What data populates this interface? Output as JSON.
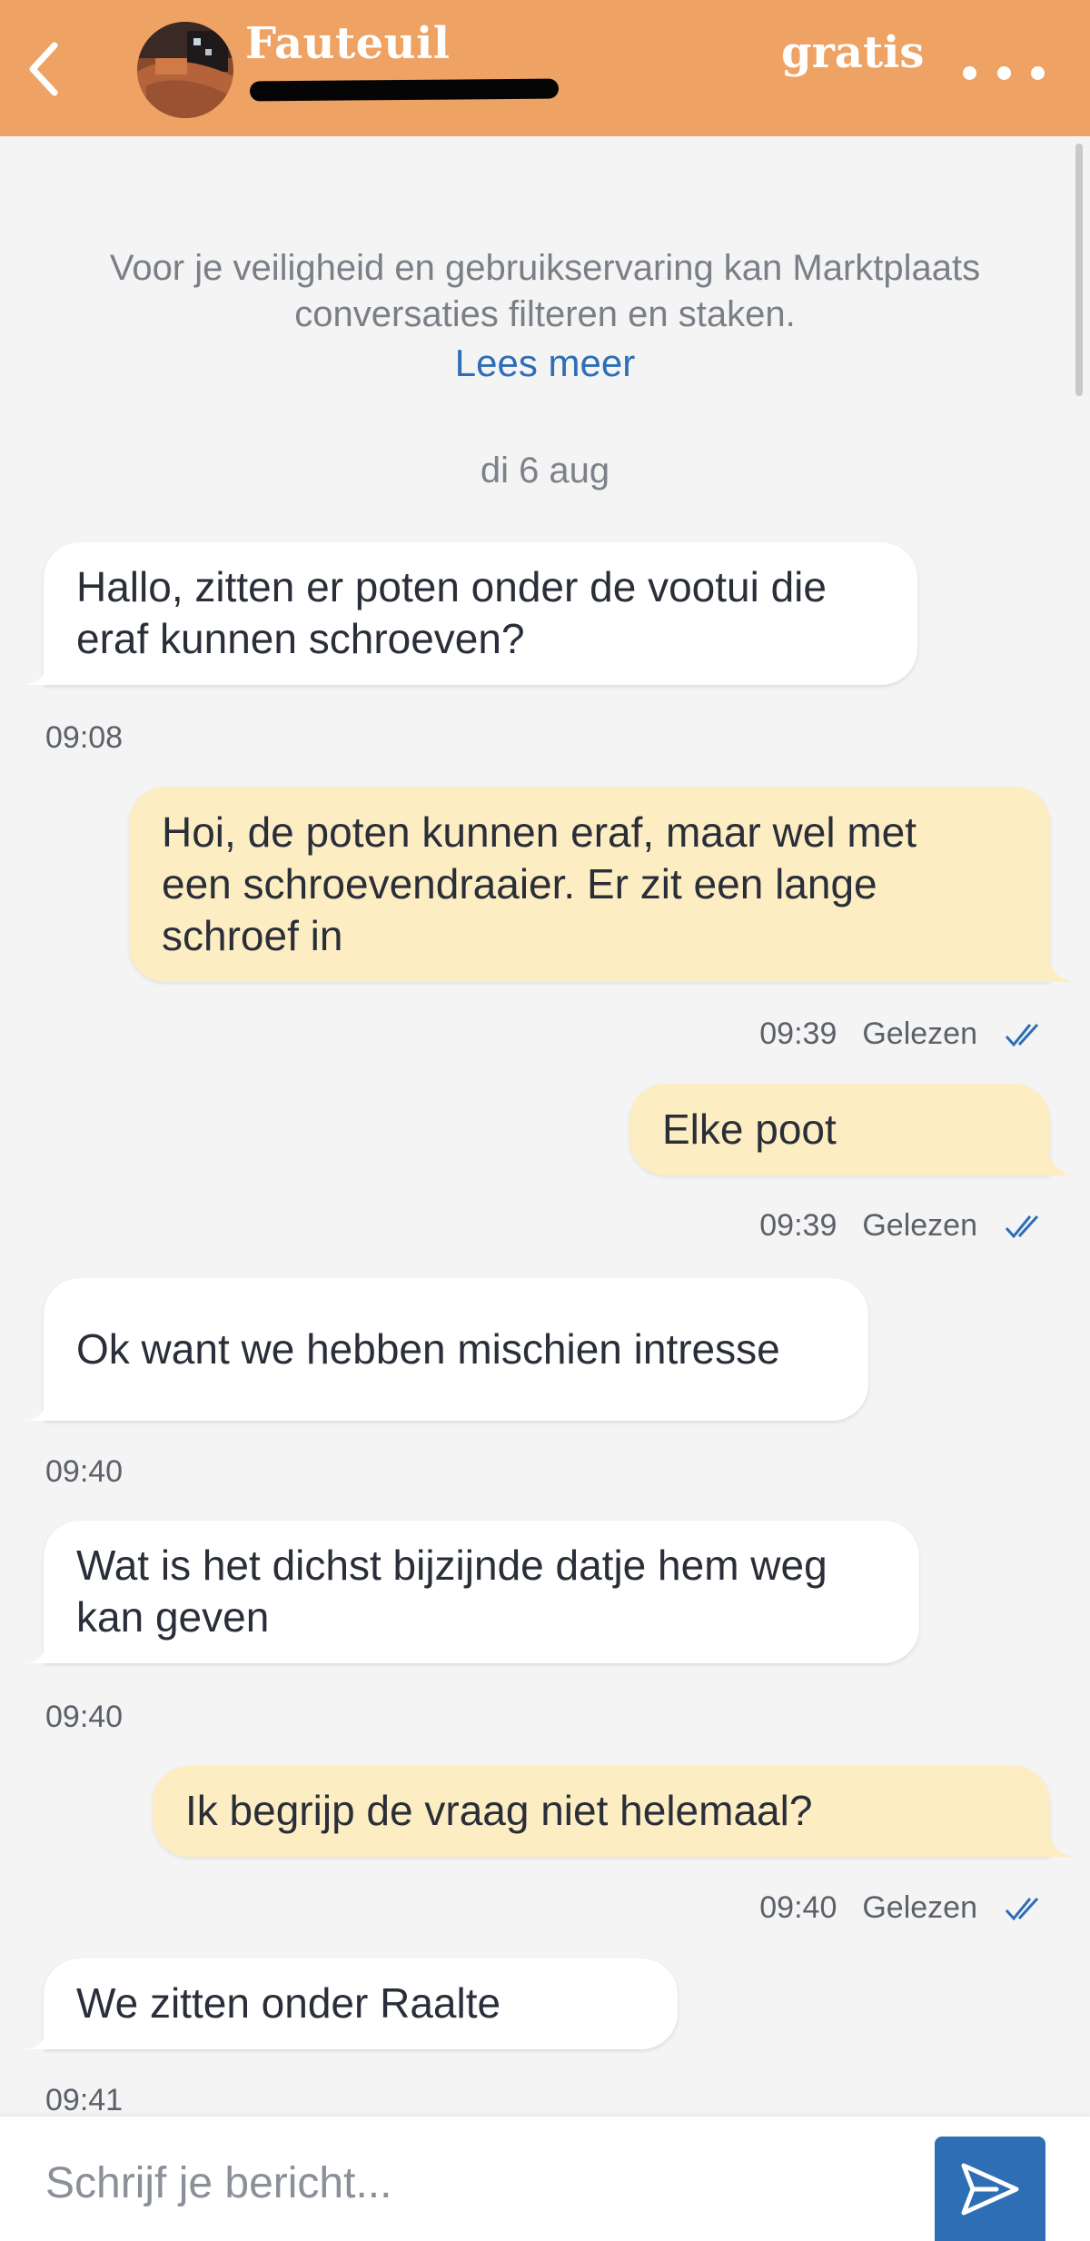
{
  "header": {
    "title": "Fauteuil",
    "subtitle": "",
    "price": "gratis",
    "colors": {
      "background": "#eea263",
      "text": "#ffffff"
    },
    "icons": {
      "back": "chevron-left-icon",
      "more": "more-dots-icon"
    }
  },
  "notice": {
    "line1": "Voor je veiligheid en gebruikservaring kan Marktplaats",
    "line2": "conversaties filteren en staken.",
    "link": "Lees meer"
  },
  "date_separator": "di 6 aug",
  "messages": [
    {
      "direction": "incoming",
      "lines": [
        "Hallo, zitten er poten onder de vootui die",
        "eraf kunnen schroeven?"
      ],
      "time": "09:08"
    },
    {
      "direction": "outgoing",
      "lines": [
        "Hoi, de poten kunnen eraf, maar wel met",
        "een schroevendraaier. Er zit een lange",
        "schroef in"
      ],
      "time": "09:39",
      "status": "Gelezen"
    },
    {
      "direction": "outgoing",
      "lines": [
        "Elke poot"
      ],
      "time": "09:39",
      "status": "Gelezen"
    },
    {
      "direction": "incoming",
      "lines": [
        "Ok want we hebben mischien intresse"
      ],
      "time": "09:40"
    },
    {
      "direction": "incoming",
      "lines": [
        "Wat is het dichst bijzijnde datje hem weg",
        "kan geven"
      ],
      "time": "09:40"
    },
    {
      "direction": "outgoing",
      "lines": [
        "Ik begrijp de vraag niet helemaal?"
      ],
      "time": "09:40",
      "status": "Gelezen"
    },
    {
      "direction": "incoming",
      "lines": [
        "We zitten onder Raalte"
      ],
      "time": "09:41"
    }
  ],
  "composer": {
    "placeholder": "Schrijf je bericht...",
    "send_icon": "send-icon"
  },
  "colors": {
    "incoming_bubble": "#ffffff",
    "outgoing_bubble": "#fdedc2",
    "accent": "#2e6eb5",
    "background": "#f4f4f4"
  }
}
